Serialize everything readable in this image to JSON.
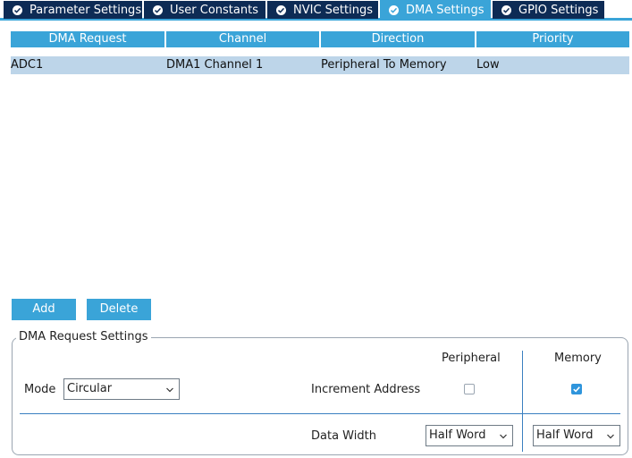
{
  "tabs": [
    {
      "label": "Parameter Settings",
      "active": false
    },
    {
      "label": "User Constants",
      "active": false
    },
    {
      "label": "NVIC Settings",
      "active": false
    },
    {
      "label": "DMA Settings",
      "active": true
    },
    {
      "label": "GPIO Settings",
      "active": false
    }
  ],
  "table": {
    "columns": [
      "DMA Request",
      "Channel",
      "Direction",
      "Priority"
    ],
    "rows": [
      [
        "ADC1",
        "DMA1 Channel 1",
        "Peripheral To Memory",
        "Low"
      ]
    ]
  },
  "buttons": {
    "add": "Add",
    "delete": "Delete"
  },
  "settings": {
    "title": "DMA Request Settings",
    "mode_label": "Mode",
    "mode_value": "Circular",
    "peripheral_header": "Peripheral",
    "memory_header": "Memory",
    "increment_label": "Increment Address",
    "increment_peripheral_checked": false,
    "increment_memory_checked": true,
    "data_width_label": "Data Width",
    "data_width_peripheral": "Half Word",
    "data_width_memory": "Half Word"
  },
  "colors": {
    "accent": "#3aa4d8",
    "tab_dark": "#0d2b55",
    "row_selected": "#bdd5e9"
  }
}
